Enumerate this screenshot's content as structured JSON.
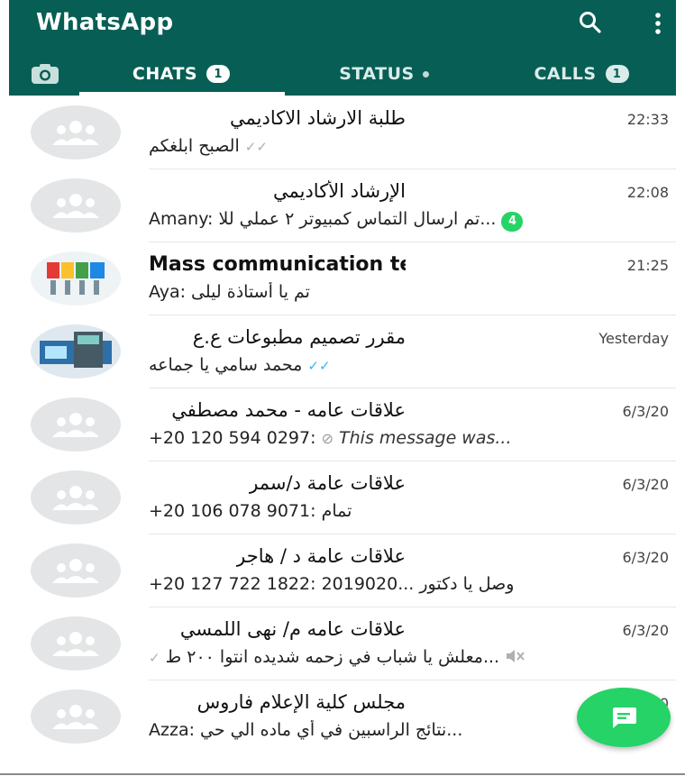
{
  "app": {
    "title": "WhatsApp"
  },
  "icons": {
    "search": "search-icon",
    "menu": "more-vert-icon",
    "camera": "camera-icon",
    "fab": "new-chat-icon",
    "group": "group-avatar-icon",
    "mute": "muted-icon",
    "blocked": "deleted-message-icon"
  },
  "colors": {
    "header": "#075e54",
    "accent": "#25d366",
    "read_ticks": "#34b7f1"
  },
  "tabs": [
    {
      "label": "CHATS",
      "badge": "1",
      "active": true
    },
    {
      "label": "STATUS",
      "badge": "",
      "active": false
    },
    {
      "label": "CALLS",
      "badge": "1",
      "active": false
    }
  ],
  "chats": [
    {
      "name": "طلبة الارشاد الاكاديمي",
      "time": "22:33",
      "preview": "الصبح ابلغكم",
      "ticks": "✓✓"
    },
    {
      "name": "الإرشاد الأكاديمي",
      "time": "22:08",
      "unread": "4",
      "preview_text": "تم ارسال التماس كمبيوتر ٢ عملي للا...",
      "sender": "Amany:"
    },
    {
      "name": "Mass communication team",
      "time": "21:25",
      "sender": "Aya:",
      "preview_text": "تم يا أستاذة ليلى"
    },
    {
      "name": "مقرر تصميم مطبوعات ع.ع",
      "time": "Yesterday",
      "preview": "محمد سامي يا جماعه",
      "ticks": "✓✓"
    },
    {
      "name": "علاقات عامه - محمد مصطفي",
      "time": "6/3/20",
      "sender": "+20 120 594 0297:",
      "preview_text": "This message was..."
    },
    {
      "name": "علاقات عامة د/سمر",
      "time": "6/3/20",
      "sender": "+20 106 078 9071:",
      "preview_text": "تمام"
    },
    {
      "name": "علاقات عامة د / هاجر",
      "time": "6/3/20",
      "sender": "+20 127 722 1822:",
      "preview_text": "وصل يا دكتور ...2019020"
    },
    {
      "name": "علاقات عامه م/ نهى اللمسي",
      "time": "6/3/20",
      "preview": "معلش يا شباب في زحمه شديده انتوا ٢٠٠ ط...",
      "ticks": "✓"
    },
    {
      "name": "مجلس كلية الإعلام فاروس",
      "time": "6/3/20",
      "sender": "Azza:",
      "preview_text": "نتائج الراسبين في أي ماده الي حي..."
    }
  ]
}
